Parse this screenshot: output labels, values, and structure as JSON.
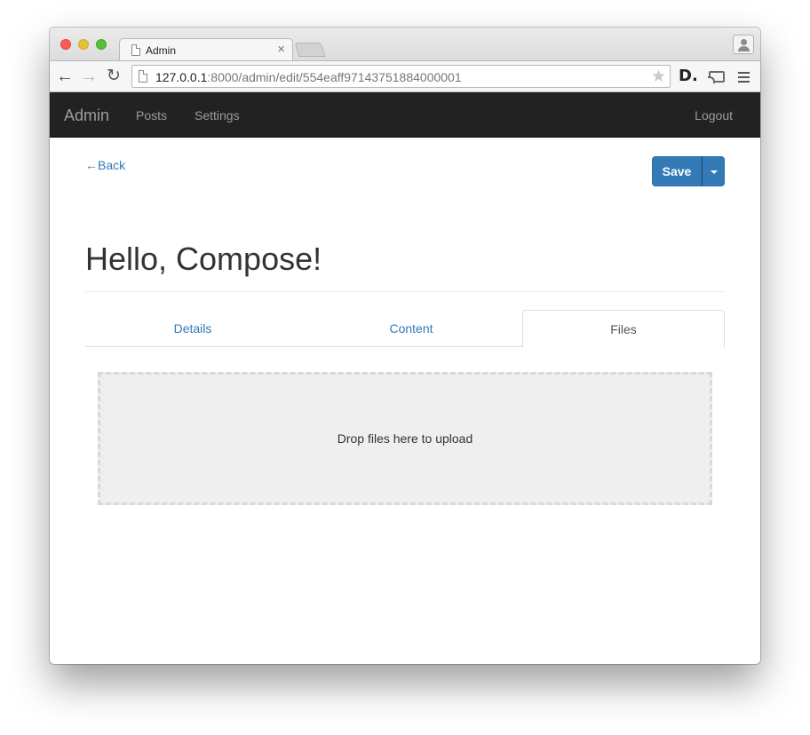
{
  "browser": {
    "tab_title": "Admin",
    "tab_close": "×",
    "url_host": "127.0.0.1",
    "url_rest": ":8000/admin/edit/554eaff97143751884000001"
  },
  "navbar": {
    "brand": "Admin",
    "links": [
      "Posts",
      "Settings"
    ],
    "logout": "Logout"
  },
  "page": {
    "back_link": "←Back",
    "save_label": "Save",
    "title": "Hello, Compose!",
    "tabs": [
      {
        "label": "Details",
        "active": false
      },
      {
        "label": "Content",
        "active": false
      },
      {
        "label": "Files",
        "active": true
      }
    ],
    "dropzone_text": "Drop files here to upload"
  },
  "colors": {
    "link": "#337ab7",
    "primary_button": "#337ab7",
    "navbar_bg": "#222222",
    "dropzone_bg": "#efefef"
  }
}
